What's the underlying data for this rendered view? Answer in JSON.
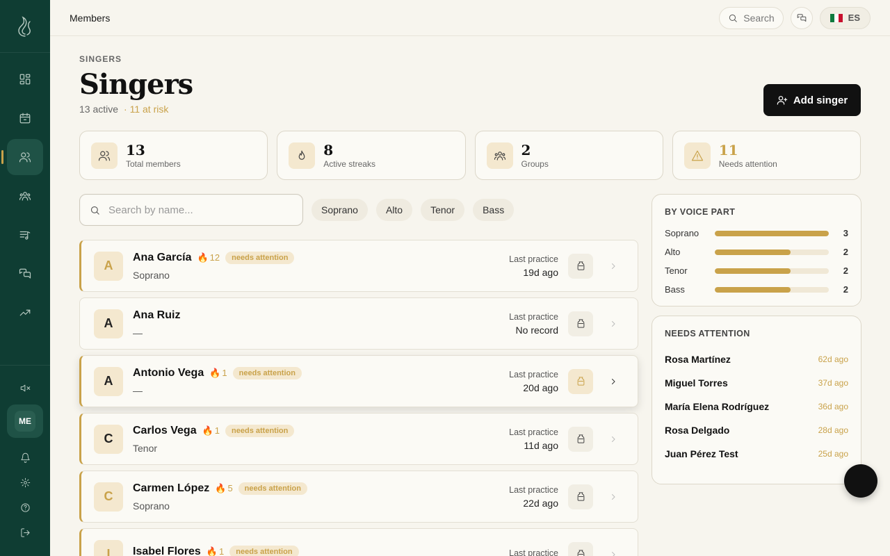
{
  "topbar": {
    "breadcrumb": "Members",
    "search_label": "Search",
    "lang_code": "ES"
  },
  "page": {
    "eyebrow": "SINGERS",
    "title": "Singers",
    "active_text": "13 active",
    "risk_text": "· 11 at risk",
    "add_button": "Add singer"
  },
  "stats": [
    {
      "value": "13",
      "label": "Total members",
      "icon": "users-icon"
    },
    {
      "value": "8",
      "label": "Active streaks",
      "icon": "flame-icon"
    },
    {
      "value": "2",
      "label": "Groups",
      "icon": "group-icon"
    },
    {
      "value": "11",
      "label": "Needs attention",
      "icon": "warning-icon"
    }
  ],
  "search": {
    "placeholder": "Search by name..."
  },
  "filters": [
    "Soprano",
    "Alto",
    "Tenor",
    "Bass"
  ],
  "singers": [
    {
      "initial": "A",
      "name": "Ana García",
      "streak": "12",
      "badge": "needs attention",
      "part": "Soprano",
      "last_label": "Last practice",
      "last": "19d ago"
    },
    {
      "initial": "A",
      "name": "Ana Ruiz",
      "streak": "",
      "badge": "",
      "part": "—",
      "last_label": "Last practice",
      "last": "No record"
    },
    {
      "initial": "A",
      "name": "Antonio Vega",
      "streak": "1",
      "badge": "needs attention",
      "part": "—",
      "last_label": "Last practice",
      "last": "20d ago"
    },
    {
      "initial": "C",
      "name": "Carlos Vega",
      "streak": "1",
      "badge": "needs attention",
      "part": "Tenor",
      "last_label": "Last practice",
      "last": "11d ago"
    },
    {
      "initial": "C",
      "name": "Carmen López",
      "streak": "5",
      "badge": "needs attention",
      "part": "Soprano",
      "last_label": "Last practice",
      "last": "22d ago"
    },
    {
      "initial": "I",
      "name": "Isabel Flores",
      "streak": "1",
      "badge": "needs attention",
      "part": "",
      "last_label": "Last practice",
      "last": ""
    }
  ],
  "voice_part": {
    "title": "BY VOICE PART",
    "rows": [
      {
        "name": "Soprano",
        "count": "3",
        "fraction": 1.0
      },
      {
        "name": "Alto",
        "count": "2",
        "fraction": 0.667
      },
      {
        "name": "Tenor",
        "count": "2",
        "fraction": 0.667
      },
      {
        "name": "Bass",
        "count": "2",
        "fraction": 0.667
      }
    ]
  },
  "needs_attention": {
    "title": "NEEDS ATTENTION",
    "rows": [
      {
        "name": "Rosa Martínez",
        "ago": "62d ago"
      },
      {
        "name": "Miguel Torres",
        "ago": "37d ago"
      },
      {
        "name": "María Elena Rodríguez",
        "ago": "36d ago"
      },
      {
        "name": "Rosa Delgado",
        "ago": "28d ago"
      },
      {
        "name": "Juan Pérez Test",
        "ago": "25d ago"
      }
    ]
  },
  "sidebar": {
    "me_initials": "ME"
  },
  "colors": {
    "sidebar": "#0f3d33",
    "accent": "#c9a24a",
    "background": "#f7f5ee"
  }
}
